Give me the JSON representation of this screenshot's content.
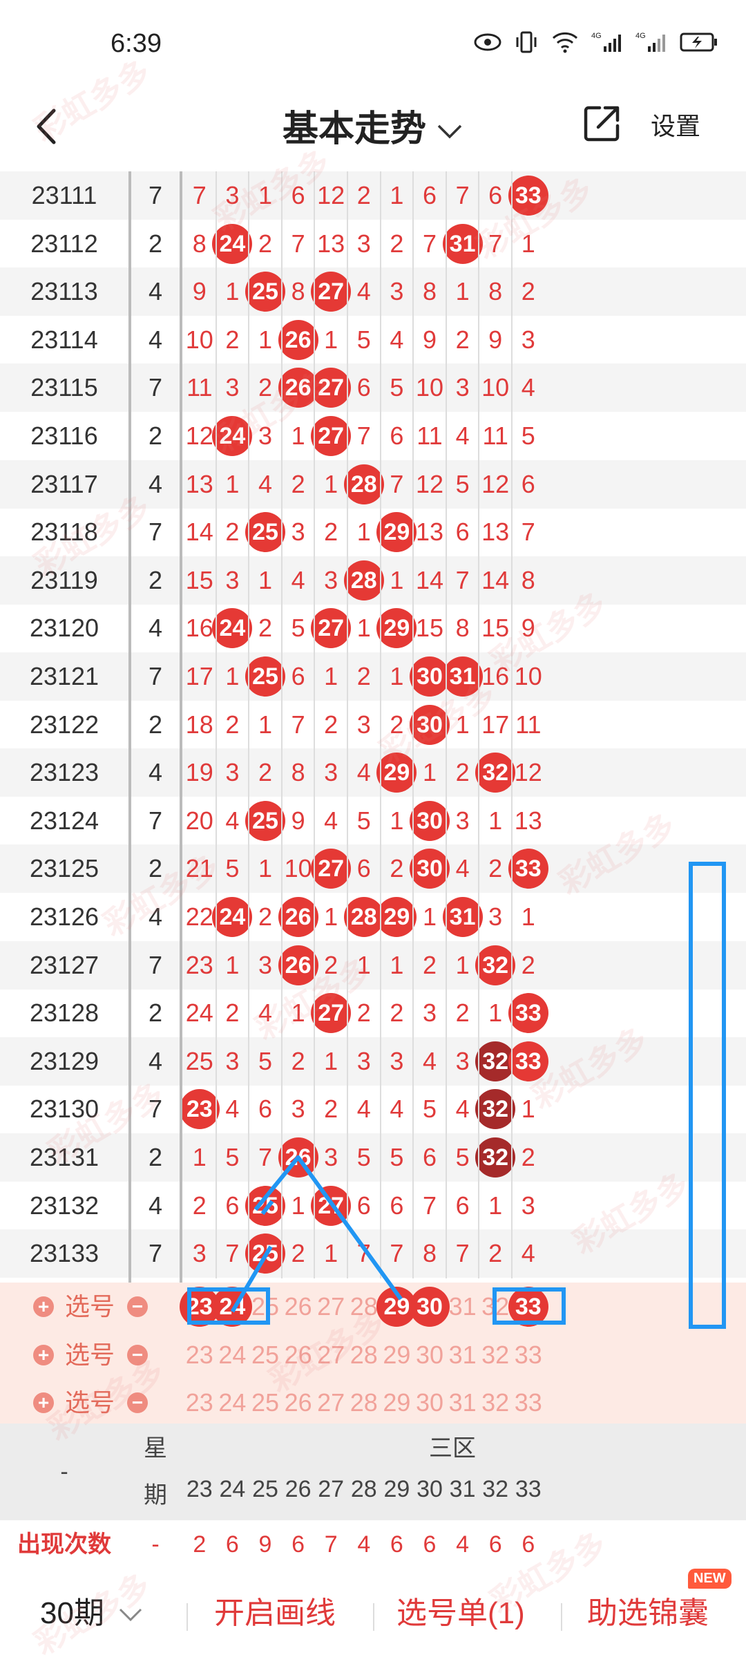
{
  "status": {
    "time": "6:39"
  },
  "header": {
    "title": "基本走势",
    "settings_label": "设置"
  },
  "rows": [
    {
      "issue": "23111",
      "week": "7",
      "cells": [
        "7",
        "3",
        "1",
        "6",
        "12",
        "2",
        "1",
        "6",
        "7",
        "6",
        "33"
      ],
      "balls": [
        10
      ],
      "dark": []
    },
    {
      "issue": "23112",
      "week": "2",
      "cells": [
        "8",
        "24",
        "2",
        "7",
        "13",
        "3",
        "2",
        "7",
        "31",
        "7",
        "1"
      ],
      "balls": [
        1,
        8
      ],
      "dark": []
    },
    {
      "issue": "23113",
      "week": "4",
      "cells": [
        "9",
        "1",
        "25",
        "8",
        "27",
        "4",
        "3",
        "8",
        "1",
        "8",
        "2"
      ],
      "balls": [
        2,
        4
      ],
      "dark": []
    },
    {
      "issue": "23114",
      "week": "4",
      "cells": [
        "10",
        "2",
        "1",
        "26",
        "1",
        "5",
        "4",
        "9",
        "2",
        "9",
        "3"
      ],
      "balls": [
        3
      ],
      "dark": []
    },
    {
      "issue": "23115",
      "week": "7",
      "cells": [
        "11",
        "3",
        "2",
        "26",
        "27",
        "6",
        "5",
        "10",
        "3",
        "10",
        "4"
      ],
      "balls": [
        3,
        4
      ],
      "dark": []
    },
    {
      "issue": "23116",
      "week": "2",
      "cells": [
        "12",
        "24",
        "3",
        "1",
        "27",
        "7",
        "6",
        "11",
        "4",
        "11",
        "5"
      ],
      "balls": [
        1,
        4
      ],
      "dark": []
    },
    {
      "issue": "23117",
      "week": "4",
      "cells": [
        "13",
        "1",
        "4",
        "2",
        "1",
        "28",
        "7",
        "12",
        "5",
        "12",
        "6"
      ],
      "balls": [
        5
      ],
      "dark": []
    },
    {
      "issue": "23118",
      "week": "7",
      "cells": [
        "14",
        "2",
        "25",
        "3",
        "2",
        "1",
        "29",
        "13",
        "6",
        "13",
        "7"
      ],
      "balls": [
        2,
        6
      ],
      "dark": []
    },
    {
      "issue": "23119",
      "week": "2",
      "cells": [
        "15",
        "3",
        "1",
        "4",
        "3",
        "28",
        "1",
        "14",
        "7",
        "14",
        "8"
      ],
      "balls": [
        5
      ],
      "dark": []
    },
    {
      "issue": "23120",
      "week": "4",
      "cells": [
        "16",
        "24",
        "2",
        "5",
        "27",
        "1",
        "29",
        "15",
        "8",
        "15",
        "9"
      ],
      "balls": [
        1,
        4,
        6
      ],
      "dark": []
    },
    {
      "issue": "23121",
      "week": "7",
      "cells": [
        "17",
        "1",
        "25",
        "6",
        "1",
        "2",
        "1",
        "30",
        "31",
        "16",
        "10"
      ],
      "balls": [
        2,
        7,
        8
      ],
      "dark": []
    },
    {
      "issue": "23122",
      "week": "2",
      "cells": [
        "18",
        "2",
        "1",
        "7",
        "2",
        "3",
        "2",
        "30",
        "1",
        "17",
        "11"
      ],
      "balls": [
        7
      ],
      "dark": []
    },
    {
      "issue": "23123",
      "week": "4",
      "cells": [
        "19",
        "3",
        "2",
        "8",
        "3",
        "4",
        "29",
        "1",
        "2",
        "32",
        "12"
      ],
      "balls": [
        6,
        9
      ],
      "dark": []
    },
    {
      "issue": "23124",
      "week": "7",
      "cells": [
        "20",
        "4",
        "25",
        "9",
        "4",
        "5",
        "1",
        "30",
        "3",
        "1",
        "13"
      ],
      "balls": [
        2,
        7
      ],
      "dark": []
    },
    {
      "issue": "23125",
      "week": "2",
      "cells": [
        "21",
        "5",
        "1",
        "10",
        "27",
        "6",
        "2",
        "30",
        "4",
        "2",
        "33"
      ],
      "balls": [
        4,
        7,
        10
      ],
      "dark": []
    },
    {
      "issue": "23126",
      "week": "4",
      "cells": [
        "22",
        "24",
        "2",
        "26",
        "1",
        "28",
        "29",
        "1",
        "31",
        "3",
        "1"
      ],
      "balls": [
        1,
        3,
        5,
        6,
        8
      ],
      "dark": []
    },
    {
      "issue": "23127",
      "week": "7",
      "cells": [
        "23",
        "1",
        "3",
        "26",
        "2",
        "1",
        "1",
        "2",
        "1",
        "32",
        "2"
      ],
      "balls": [
        3,
        9
      ],
      "dark": []
    },
    {
      "issue": "23128",
      "week": "2",
      "cells": [
        "24",
        "2",
        "4",
        "1",
        "27",
        "2",
        "2",
        "3",
        "2",
        "1",
        "33"
      ],
      "balls": [
        4,
        10
      ],
      "dark": []
    },
    {
      "issue": "23129",
      "week": "4",
      "cells": [
        "25",
        "3",
        "5",
        "2",
        "1",
        "3",
        "3",
        "4",
        "3",
        "32",
        "33"
      ],
      "balls": [
        9,
        10
      ],
      "dark": [
        9
      ]
    },
    {
      "issue": "23130",
      "week": "7",
      "cells": [
        "23",
        "4",
        "6",
        "3",
        "2",
        "4",
        "4",
        "5",
        "4",
        "32",
        "1"
      ],
      "balls": [
        0,
        9
      ],
      "dark": [
        9
      ]
    },
    {
      "issue": "23131",
      "week": "2",
      "cells": [
        "1",
        "5",
        "7",
        "26",
        "3",
        "5",
        "5",
        "6",
        "5",
        "32",
        "2"
      ],
      "balls": [
        3,
        9
      ],
      "dark": [
        9
      ]
    },
    {
      "issue": "23132",
      "week": "4",
      "cells": [
        "2",
        "6",
        "25",
        "1",
        "27",
        "6",
        "6",
        "7",
        "6",
        "1",
        "3"
      ],
      "balls": [
        2,
        4
      ],
      "dark": []
    },
    {
      "issue": "23133",
      "week": "7",
      "cells": [
        "3",
        "7",
        "25",
        "2",
        "1",
        "7",
        "7",
        "8",
        "7",
        "2",
        "4"
      ],
      "balls": [
        2
      ],
      "dark": []
    }
  ],
  "pick": {
    "label": "选号",
    "numbers": [
      "23",
      "24",
      "25",
      "26",
      "27",
      "28",
      "29",
      "30",
      "31",
      "32",
      "33"
    ],
    "selected_first_row": [
      0,
      1,
      6,
      7,
      10
    ]
  },
  "footer": {
    "dash": "-",
    "week_label": [
      "星",
      "期"
    ],
    "zone_label": "三区",
    "column_numbers": [
      "23",
      "24",
      "25",
      "26",
      "27",
      "28",
      "29",
      "30",
      "31",
      "32",
      "33"
    ],
    "count_label": "出现次数",
    "count_dash": "-",
    "counts": [
      "2",
      "6",
      "9",
      "6",
      "7",
      "4",
      "6",
      "6",
      "4",
      "6",
      "6"
    ]
  },
  "bottombar": {
    "period": "30期",
    "draw_line": "开启画线",
    "pick_list": "选号单(1)",
    "assist": "助选锦囊",
    "new_badge": "NEW"
  },
  "colors": {
    "ball": "#e53935",
    "ball_dark": "#a52a2a",
    "annotation": "#2196f3",
    "pick_bg": "#fdeae4"
  },
  "watermark": "彩虹多多"
}
